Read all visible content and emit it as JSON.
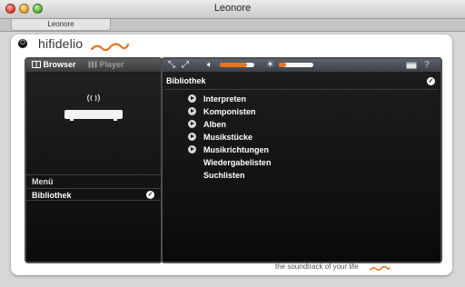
{
  "window": {
    "title": "Leonore",
    "tab": "Leonore"
  },
  "app": {
    "logo": "hifidelio",
    "tagline": "the soundtrack of your life"
  },
  "left": {
    "browser_label": "Browser",
    "player_label": "Player",
    "menu_label": "Menü",
    "bibliothek_label": "Bibliothek"
  },
  "toolbar": {
    "help": "?",
    "volume_level": 0.78,
    "brightness_level": 0.22
  },
  "right": {
    "breadcrumb": "Bibliothek",
    "items": [
      {
        "label": "Interpreten",
        "arrow": true
      },
      {
        "label": "Komponisten",
        "arrow": true
      },
      {
        "label": "Alben",
        "arrow": true
      },
      {
        "label": "Musikstücke",
        "arrow": true
      },
      {
        "label": "Musikrichtungen",
        "arrow": true
      },
      {
        "label": "Wiedergabelisten",
        "arrow": false
      },
      {
        "label": "Suchlisten",
        "arrow": false
      }
    ]
  },
  "colors": {
    "accent": "#e8731f",
    "panel": "#141414",
    "toolbar": "#4a4f58"
  }
}
